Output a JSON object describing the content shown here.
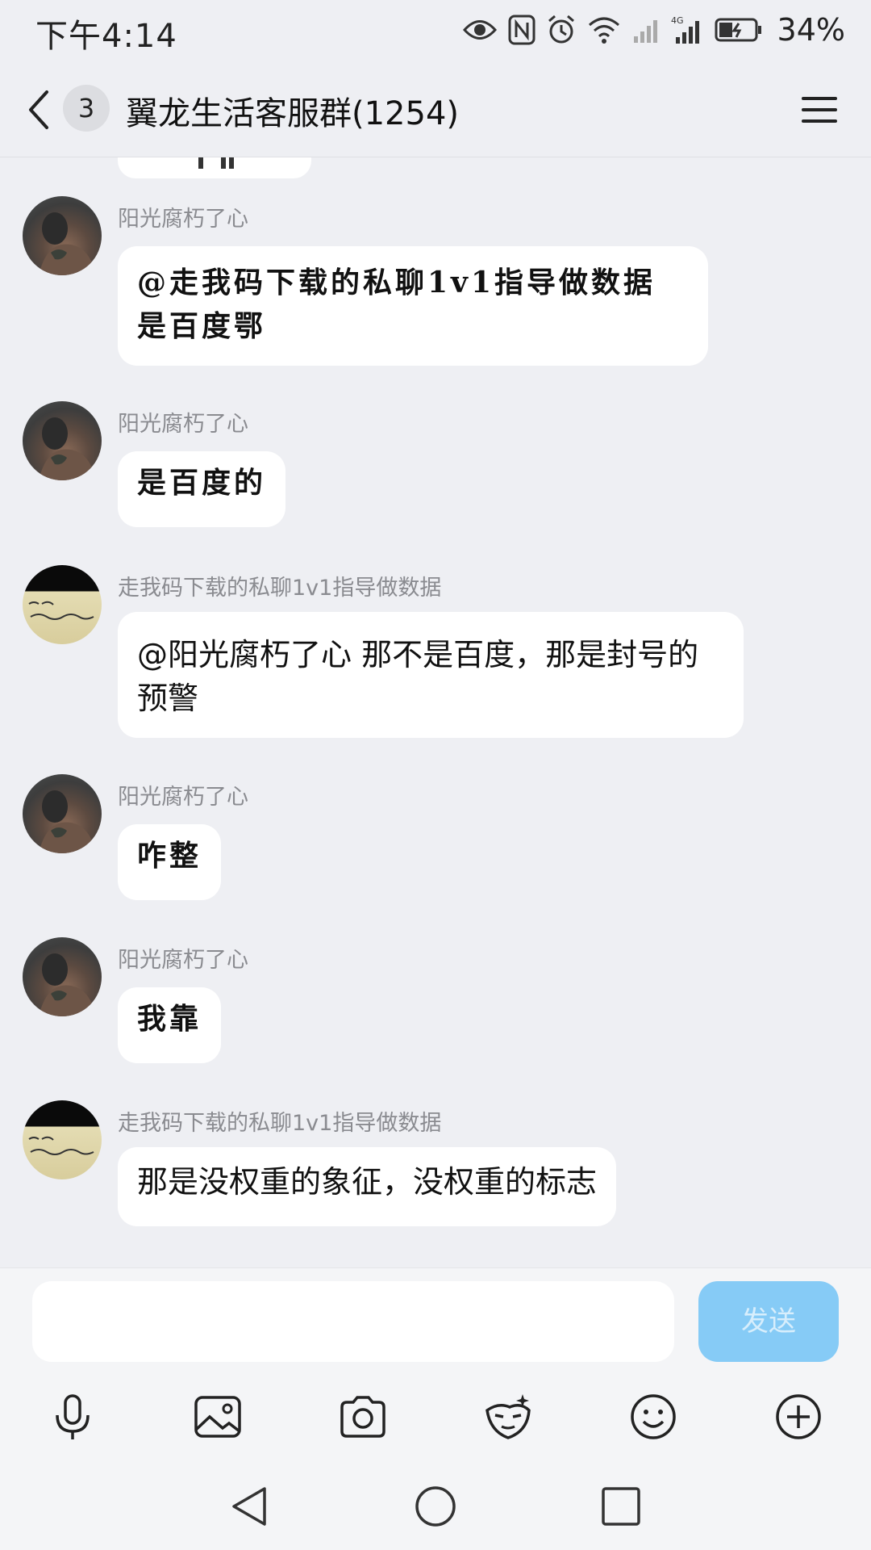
{
  "status_bar": {
    "time": "下午4:14",
    "battery": "34%"
  },
  "header": {
    "unread_count": "3",
    "title": "翼龙生活客服群(1254)"
  },
  "messages": [
    {
      "sender": "阳光腐朽了心",
      "avatar": "avatar-tattoo",
      "text": "@走我码下载的私聊1v1指导做数据 是百度鄂",
      "style": "handwritten"
    },
    {
      "sender": "阳光腐朽了心",
      "avatar": "avatar-tattoo",
      "text": "是百度的",
      "style": "handwritten"
    },
    {
      "sender": "走我码下载的私聊1v1指导做数据",
      "avatar": "avatar-handwriting",
      "text": "@阳光腐朽了心 那不是百度，那是封号的预警",
      "style": "normal"
    },
    {
      "sender": "阳光腐朽了心",
      "avatar": "avatar-tattoo",
      "text": "咋整",
      "style": "handwritten"
    },
    {
      "sender": "阳光腐朽了心",
      "avatar": "avatar-tattoo",
      "text": "我靠",
      "style": "handwritten"
    },
    {
      "sender": "走我码下载的私聊1v1指导做数据",
      "avatar": "avatar-handwriting",
      "text": "那是没权重的象征，没权重的标志",
      "style": "normal"
    }
  ],
  "input": {
    "value": "",
    "placeholder": "",
    "send_label": "发送"
  },
  "toolbar": {
    "items": [
      "microphone-icon",
      "image-icon",
      "camera-icon",
      "face-effect-icon",
      "emoji-icon",
      "plus-icon"
    ]
  },
  "colors": {
    "background": "#eeeff3",
    "bubble": "#ffffff",
    "send_button": "#86cbf6",
    "sender_text": "#8a8b90"
  }
}
